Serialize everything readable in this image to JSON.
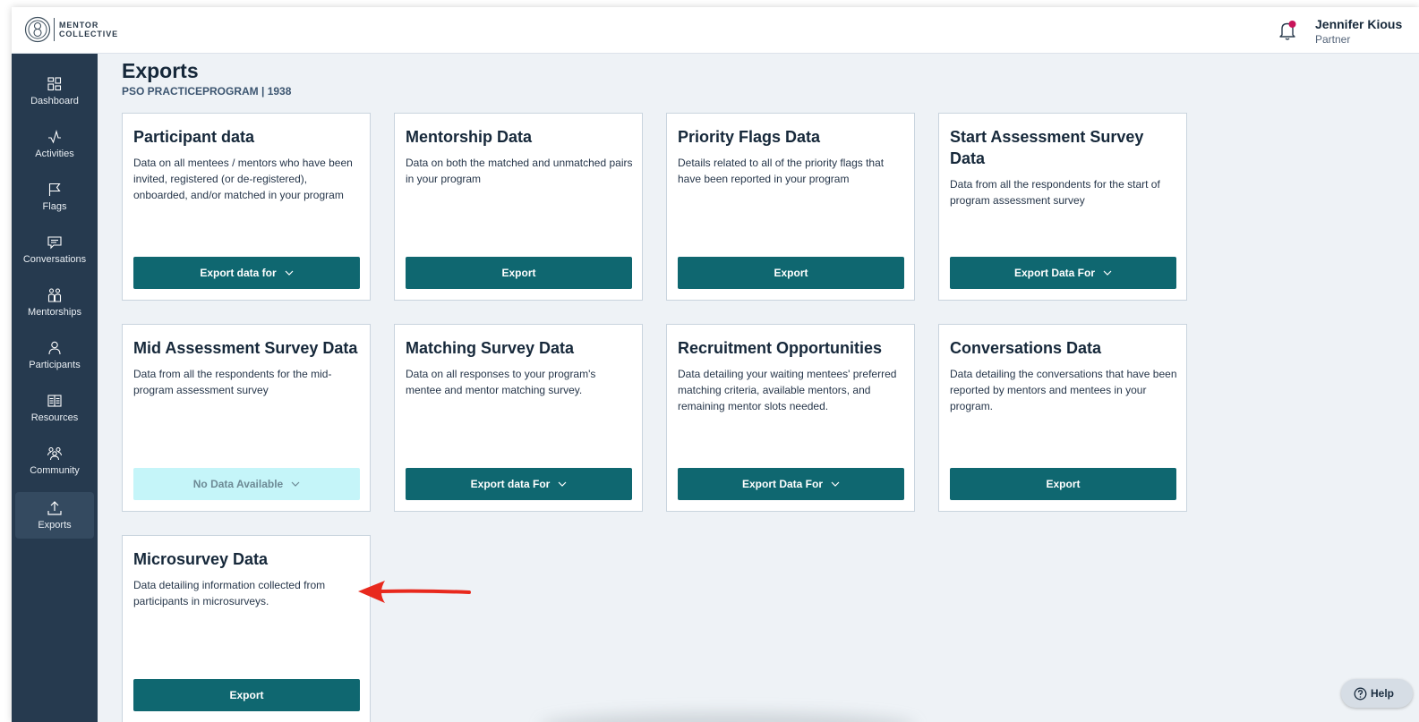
{
  "app": {
    "logo_line1": "MENTOR",
    "logo_line2": "COLLECTIVE"
  },
  "user": {
    "name": "Jennifer Kious",
    "role": "Partner"
  },
  "colors": {
    "sidebar": "#263a4f",
    "primary_button": "#0f6770",
    "disabled_button": "#c5f5f9",
    "notification_dot": "#c8145a",
    "annotation_arrow": "#e8291d"
  },
  "sidebar": {
    "items": [
      {
        "label": "Dashboard",
        "icon": "dashboard-icon"
      },
      {
        "label": "Activities",
        "icon": "activity-icon"
      },
      {
        "label": "Flags",
        "icon": "flag-icon"
      },
      {
        "label": "Conversations",
        "icon": "chat-icon"
      },
      {
        "label": "Mentorships",
        "icon": "mentorship-icon"
      },
      {
        "label": "Participants",
        "icon": "person-icon"
      },
      {
        "label": "Resources",
        "icon": "book-icon"
      },
      {
        "label": "Community",
        "icon": "community-icon"
      },
      {
        "label": "Exports",
        "icon": "upload-icon",
        "active": true
      }
    ]
  },
  "page": {
    "title": "Exports",
    "subtitle": "PSO PRACTICEPROGRAM | 1938"
  },
  "cards": [
    {
      "title": "Participant data",
      "description": "Data on all mentees / mentors who have been invited, registered (or de-registered), onboarded, and/or matched in your program",
      "button": "Export data for",
      "dropdown": true
    },
    {
      "title": "Mentorship Data",
      "description": "Data on both the matched and unmatched pairs in your program",
      "button": "Export",
      "dropdown": false
    },
    {
      "title": "Priority Flags Data",
      "description": "Details related to all of the priority flags that have been reported in your program",
      "button": "Export",
      "dropdown": false
    },
    {
      "title": "Start Assessment Survey Data",
      "description": "Data from all the respondents for the start of program assessment survey",
      "button": "Export Data For",
      "dropdown": true
    },
    {
      "title": "Mid Assessment Survey Data",
      "description": "Data from all the respondents for the mid-program assessment survey",
      "button": "No Data Available",
      "dropdown": true,
      "disabled": true
    },
    {
      "title": "Matching Survey Data",
      "description": "Data on all responses to your program's mentee and mentor matching survey.",
      "button": "Export data For",
      "dropdown": true
    },
    {
      "title": "Recruitment Opportunities",
      "description": "Data detailing your waiting mentees' preferred matching criteria, available mentors, and remaining mentor slots needed.",
      "button": "Export Data For",
      "dropdown": true
    },
    {
      "title": "Conversations Data",
      "description": "Data detailing the conversations that have been reported by mentors and mentees in your program.",
      "button": "Export",
      "dropdown": false
    },
    {
      "title": "Microsurvey Data",
      "description": "Data detailing information collected from participants in microsurveys.",
      "button": "Export",
      "dropdown": false
    }
  ],
  "help": {
    "label": "Help"
  }
}
